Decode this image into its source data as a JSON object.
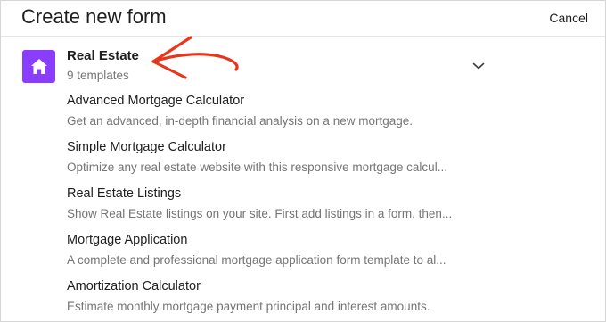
{
  "header": {
    "title": "Create new form",
    "cancel_label": "Cancel"
  },
  "category": {
    "icon": "home-icon",
    "accent_color": "#8b3dff",
    "name": "Real Estate",
    "count": "9 templates",
    "annotation_color": "#e8361c"
  },
  "templates": [
    {
      "title": "Advanced Mortgage Calculator",
      "description": "Get an advanced, in-depth financial analysis on a new mortgage."
    },
    {
      "title": "Simple Mortgage Calculator",
      "description": "Optimize any real estate website with this responsive mortgage calcul..."
    },
    {
      "title": "Real Estate Listings",
      "description": "Show Real Estate listings on your site. First add listings in a form, then..."
    },
    {
      "title": "Mortgage Application",
      "description": "A complete and professional mortgage application form template to al..."
    },
    {
      "title": "Amortization Calculator",
      "description": "Estimate monthly mortgage payment principal and interest amounts."
    }
  ]
}
